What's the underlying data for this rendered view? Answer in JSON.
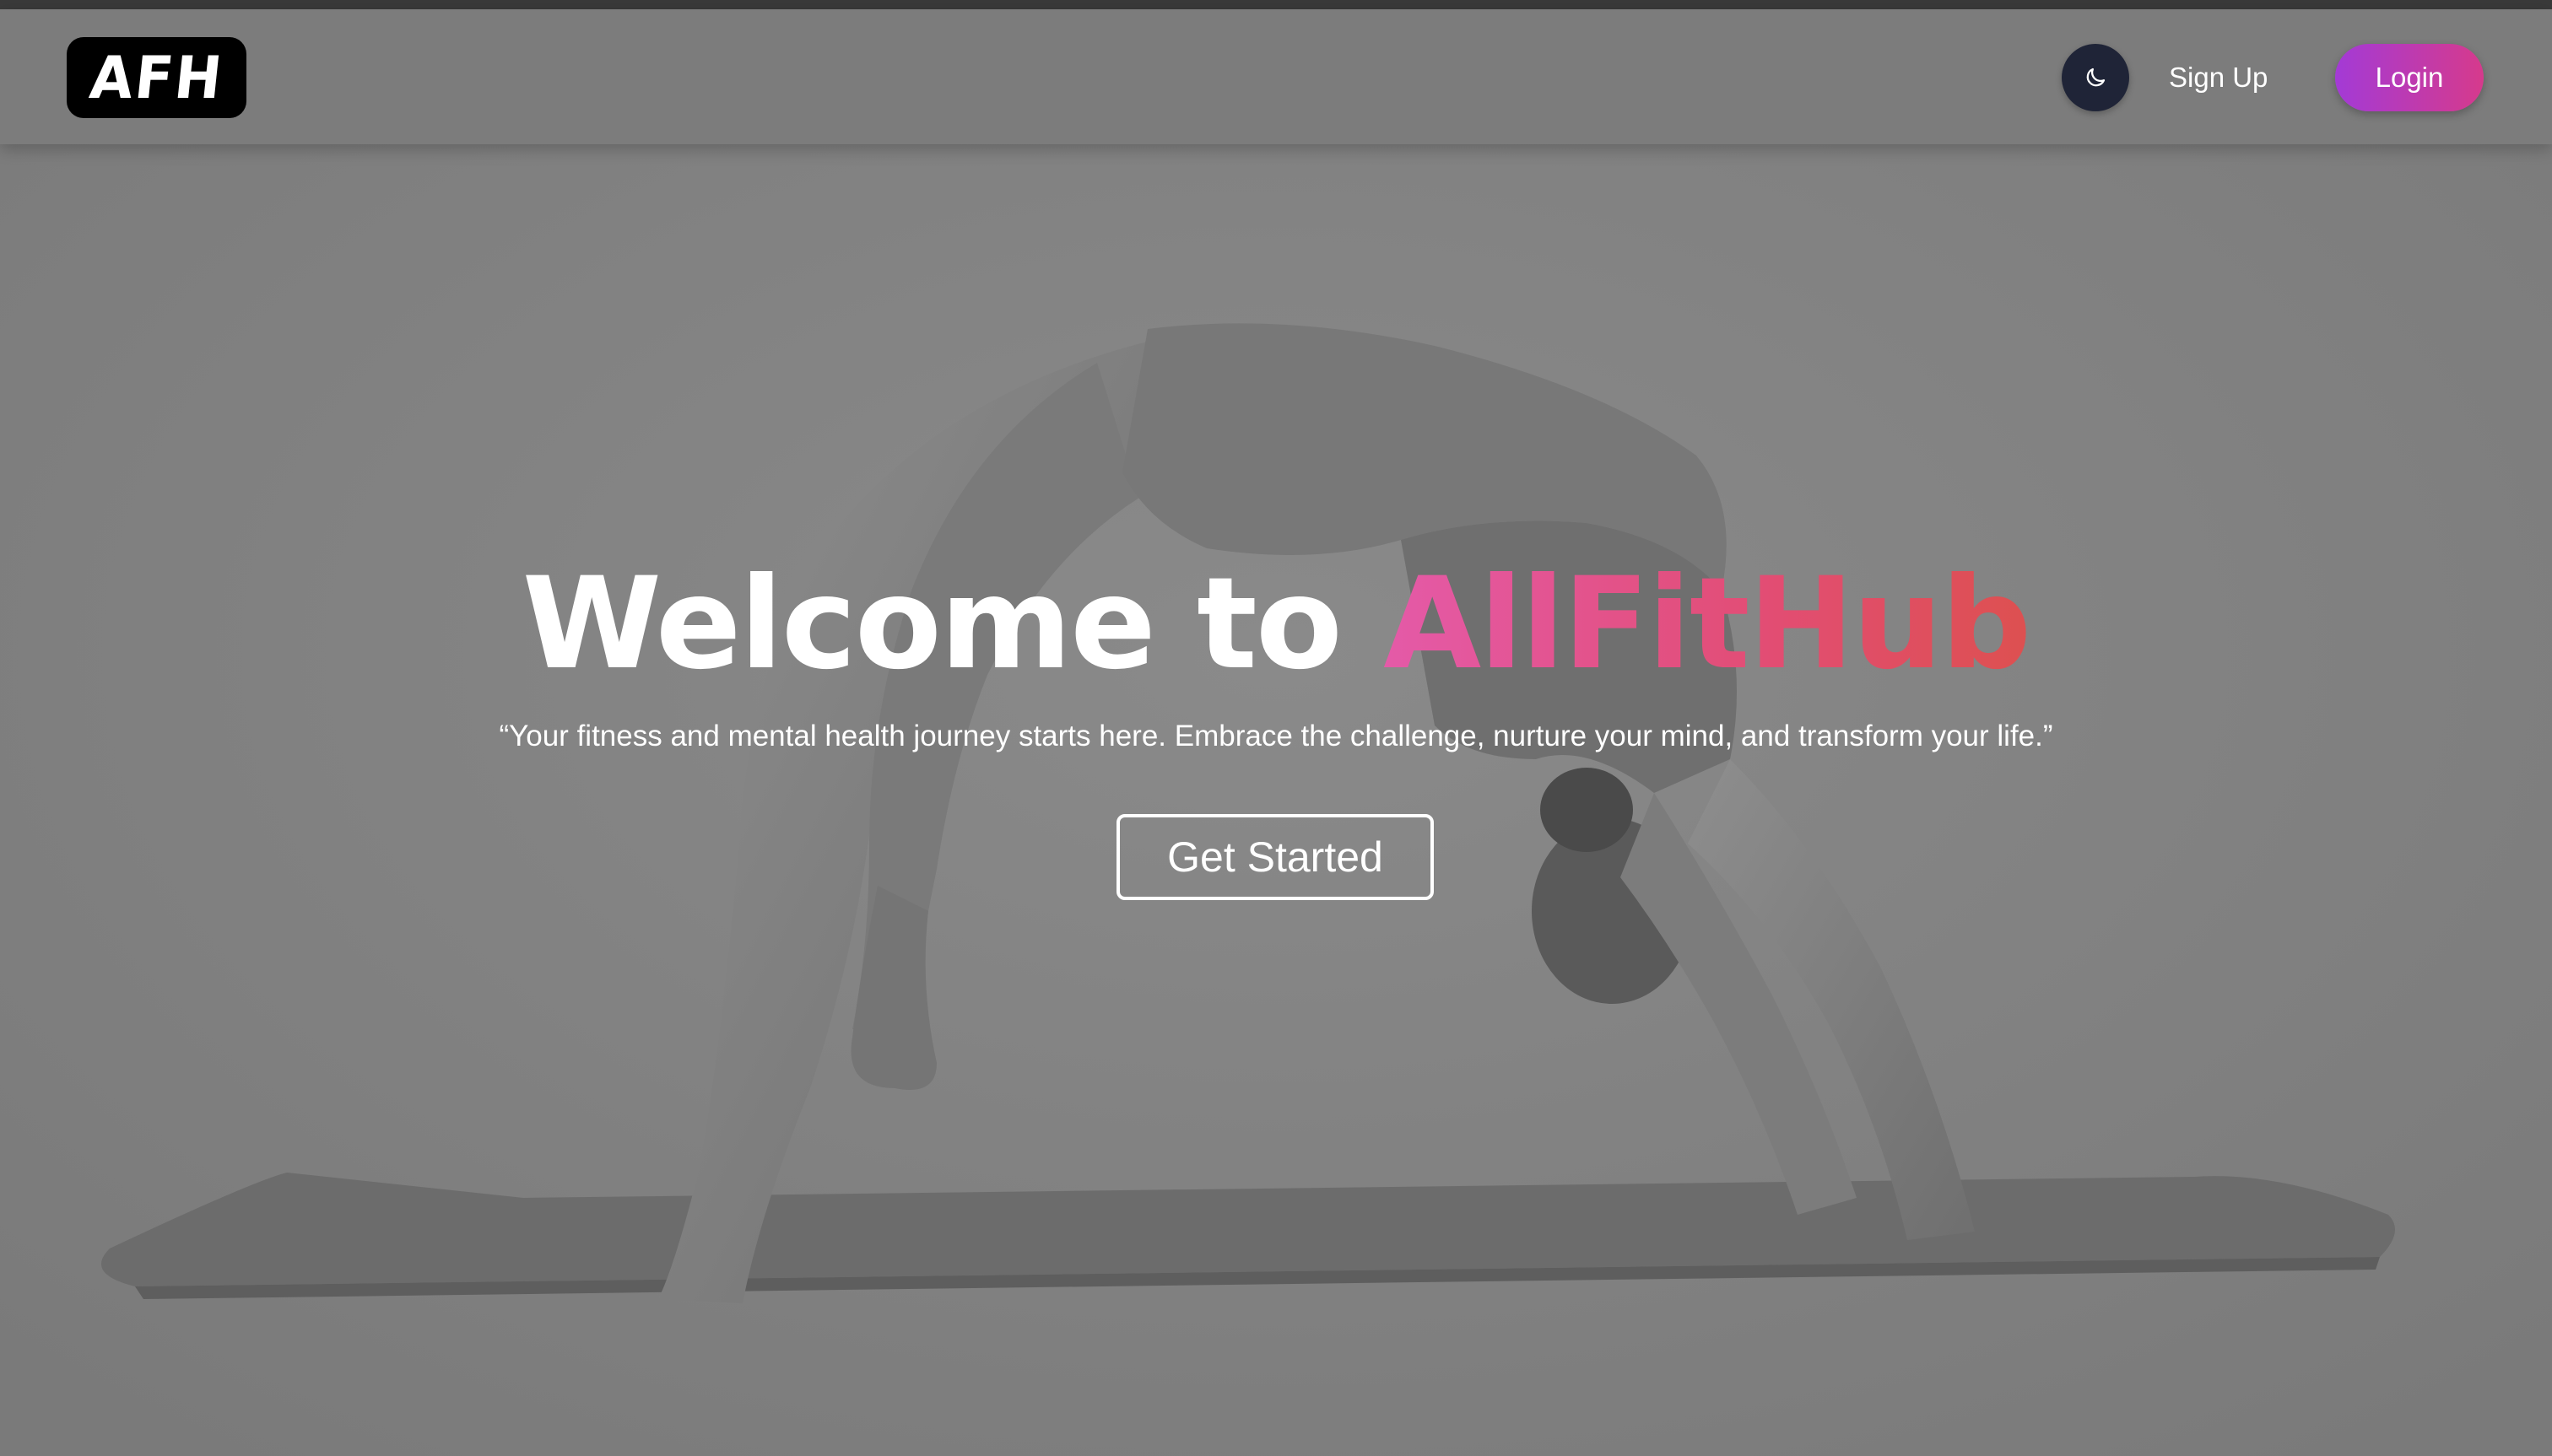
{
  "navbar": {
    "logo_text": "AFH",
    "theme_toggle_icon": "moon-icon",
    "signup_label": "Sign Up",
    "login_label": "Login"
  },
  "hero": {
    "title_prefix": "Welcome to ",
    "title_brand": "AllFitHub",
    "quote": "“Your fitness and mental health journey starts here. Embrace the challenge, nurture your mind, and transform your life.”",
    "cta_label": "Get Started"
  },
  "colors": {
    "navbar_bg": "#7c7c7c",
    "toggle_bg": "#1f2437",
    "login_gradient_start": "#a33ad6",
    "login_gradient_end": "#d63a8c",
    "brand_gradient_start": "#e45aa8",
    "brand_gradient_end": "#dd5050"
  }
}
